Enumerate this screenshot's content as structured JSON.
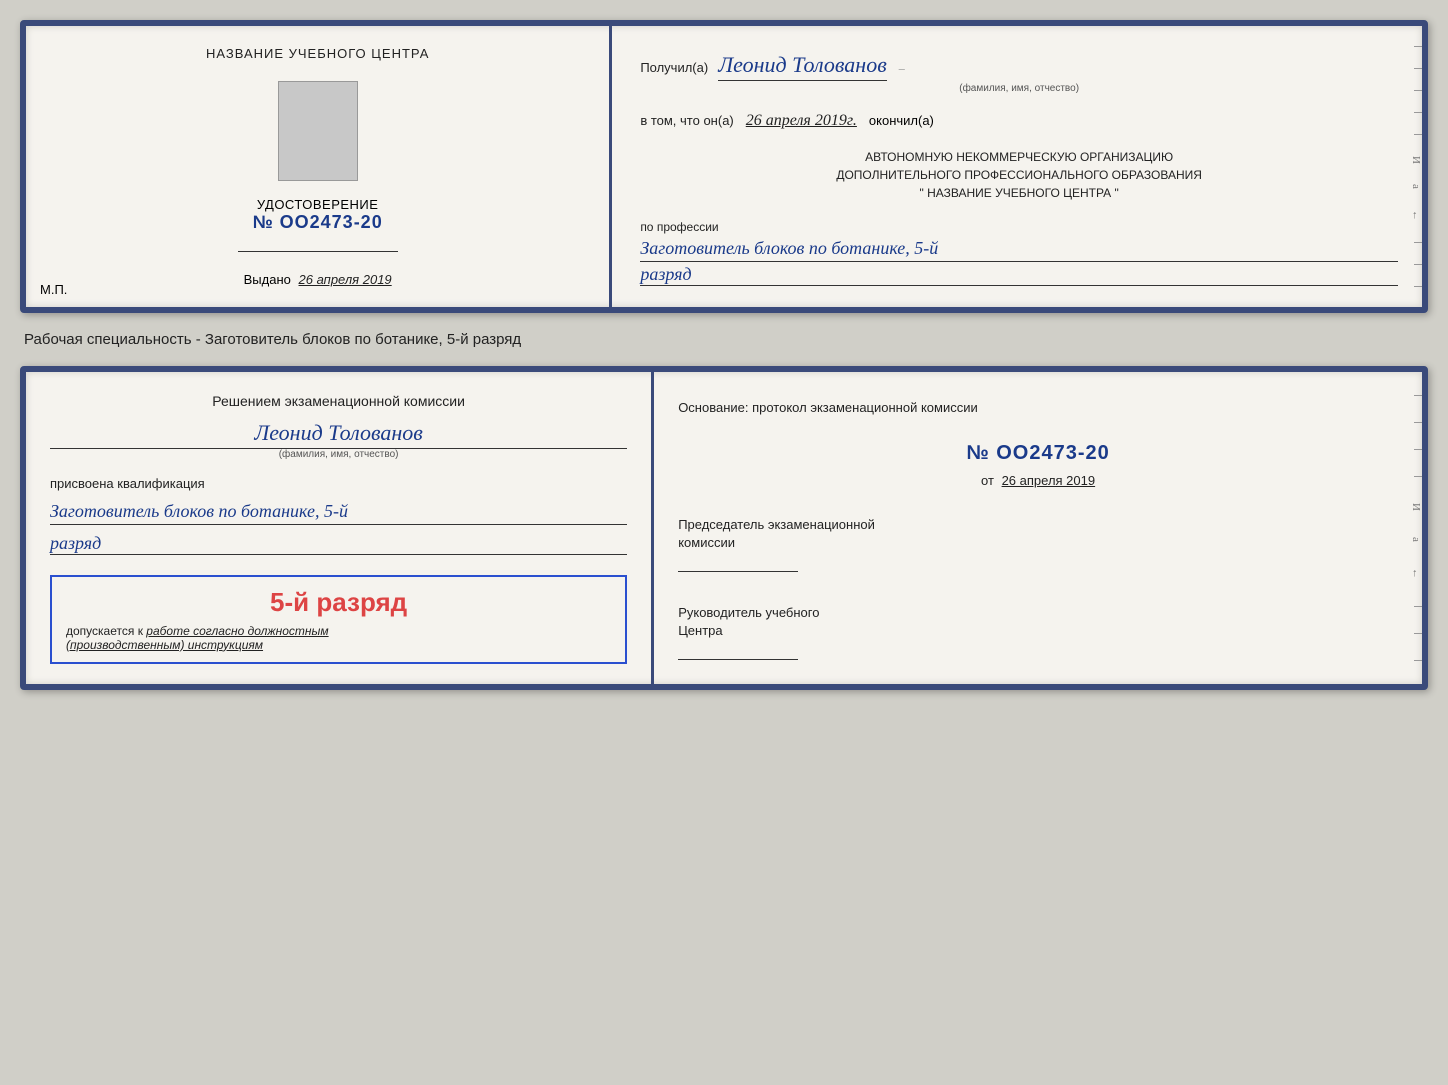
{
  "doc1": {
    "left": {
      "center_title": "НАЗВАНИЕ УЧЕБНОГО ЦЕНТРА",
      "cert_label": "УДОСТОВЕРЕНИЕ",
      "cert_number": "№ OO2473-20",
      "issued_label": "Выдано",
      "issued_date": "26 апреля 2019",
      "mp_label": "М.П."
    },
    "right": {
      "received_prefix": "Получил(а)",
      "recipient_name": "Леонид Толованов",
      "fio_label": "(фамилия, имя, отчество)",
      "vtom_prefix": "в том, что он(а)",
      "vtom_date": "26 апреля 2019г.",
      "okoncil": "окончил(а)",
      "org_line1": "АВТОНОМНУЮ НЕКОММЕРЧЕСКУЮ ОРГАНИЗАЦИЮ",
      "org_line2": "ДОПОЛНИТЕЛЬНОГО ПРОФЕССИОНАЛЬНОГО ОБРАЗОВАНИЯ",
      "org_line3": "\"  НАЗВАНИЕ УЧЕБНОГО ЦЕНТРА  \"",
      "profession_label": "по профессии",
      "profession_value": "Заготовитель блоков по ботанике, 5-й",
      "razryad_value": "разряд"
    }
  },
  "specialty_text": "Рабочая специальность - Заготовитель блоков по ботанике, 5-й разряд",
  "doc2": {
    "left": {
      "title_line1": "Решением экзаменационной комиссии",
      "name": "Леонид Толованов",
      "fio_label": "(фамилия, имя, отчество)",
      "prisvoena": "присвоена квалификация",
      "qual_value": "Заготовитель блоков по ботанике, 5-й",
      "razryad_value": "разряд",
      "stamp_rank": "5-й разряд",
      "stamp_dopuskaetsya": "допускается к",
      "stamp_italic": "работе согласно должностным",
      "stamp_italic2": "(производственным) инструкциям"
    },
    "right": {
      "osnov_label": "Основание: протокол экзаменационной комиссии",
      "protocol_number": "№ OO2473-20",
      "ot_prefix": "от",
      "ot_date": "26 апреля 2019",
      "predsedatel_label": "Председатель экзаменационной",
      "predsedatel_label2": "комиссии",
      "rukovoditel_label": "Руководитель учебного",
      "rukovoditel_label2": "Центра"
    }
  }
}
